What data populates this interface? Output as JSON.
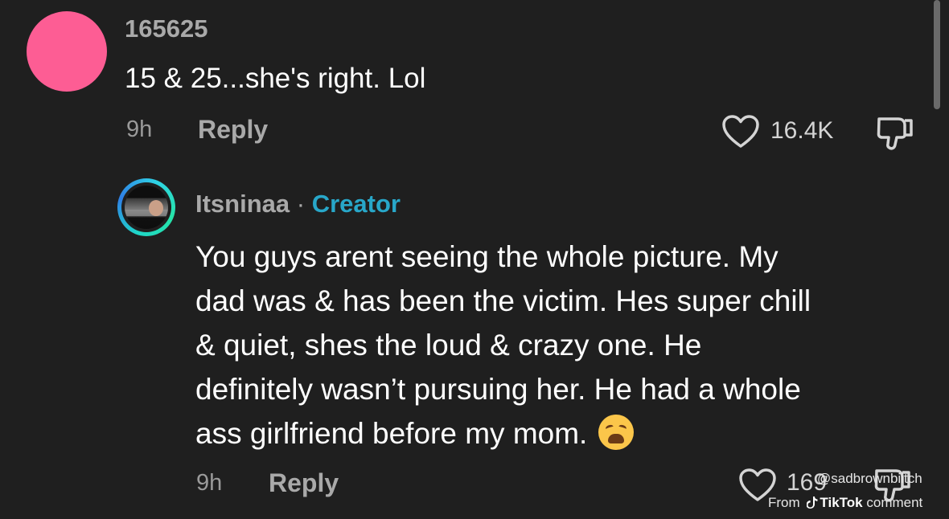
{
  "comments": [
    {
      "username": "165625",
      "text": "15 & 25...she's right. Lol",
      "time": "9h",
      "reply_label": "Reply",
      "likes": "16.4K",
      "avatar_color": "#fd5d94"
    }
  ],
  "creator_reply": {
    "username": "Itsninaa",
    "separator": "·",
    "badge": "Creator",
    "badge_color": "#28a7c9",
    "text_lines": [
      "You guys arent seeing the whole picture. My",
      "dad was & has been the victim. Hes super chill",
      "& quiet, shes the loud & crazy one. He",
      "definitely wasn’t pursuing her. He had a whole",
      "ass girlfriend before my mom."
    ],
    "emoji_icon": "weary-face-emoji",
    "time": "9h",
    "reply_label": "Reply",
    "likes": "169"
  },
  "watermark": {
    "handle": "@sadbrownbiitch",
    "prefix": "From",
    "brand": "TikTok",
    "suffix": "comment"
  },
  "colors": {
    "background": "#1f1f1f",
    "muted_text": "#a9a9a9",
    "primary_text": "#ffffff"
  }
}
